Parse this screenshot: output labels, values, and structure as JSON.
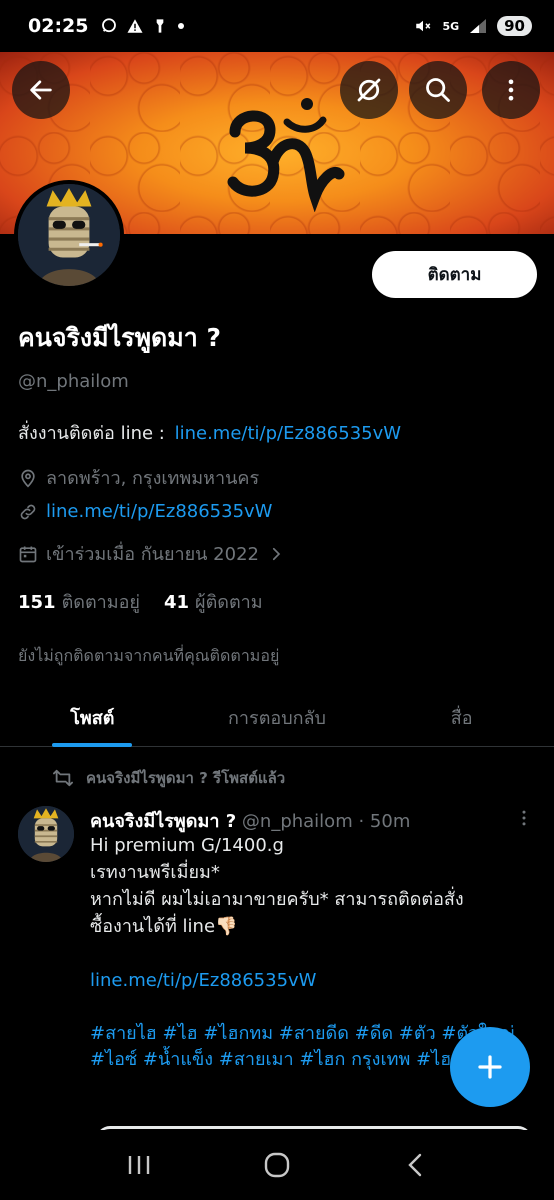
{
  "status_bar": {
    "time": "02:25",
    "network": "5G",
    "battery": "90"
  },
  "header": {
    "back_icon": "arrow-left-icon",
    "hide_icon": "eye-off-icon",
    "search_icon": "search-icon",
    "more_icon": "more-vertical-icon"
  },
  "profile": {
    "display_name": "คนจริงมีไรพูดมา ?",
    "handle": "@n_phailom",
    "follow_label": "ติดตาม",
    "bio_text": "สั่งงานติดต่อ line  :",
    "bio_link": "line.me/ti/p/Ez886535vW",
    "location": "ลาดพร้าว, กรุงเทพมหานคร",
    "website": "line.me/ti/p/Ez886535vW",
    "joined": "เข้าร่วมเมื่อ กันยายน 2022",
    "following_count": "151",
    "following_label": "ติดตามอยู่",
    "followers_count": "41",
    "followers_label": "ผู้ติดตาม",
    "not_followed_note": "ยังไม่ถูกติดตามจากคนที่คุณติดตามอยู่"
  },
  "tabs": [
    {
      "label": "โพสต์",
      "active": true
    },
    {
      "label": "การตอบกลับ",
      "active": false
    },
    {
      "label": "สื่อ",
      "active": false
    }
  ],
  "post": {
    "repost_text": "คนจริงมีไรพูดมา ? รีโพสต์แล้ว",
    "author_name": "คนจริงมีไรพูดมา ?",
    "author_handle": "@n_phailom",
    "time": "· 50m",
    "line1": "Hi premium G/1400.g",
    "line2": "เรทงานพรีเมี่ยม*",
    "line3": "หากไม่ดี ผมไม่เอามาขายครับ* สามารถติดต่อสั่ง",
    "line4": "ซื้องานได้ที่ line👎🏻",
    "link": "line.me/ti/p/Ez886535vW",
    "hashtags": "#สายไฮ #ไฮ #ไฮกทม #สายดีด #ดีด #ตัว #ตัวใหญ่ #ไอซ์ #น้ำแข็ง #สายเมา #ไฮก กรุงเทพ #ไฮกทม"
  },
  "fab": {
    "icon": "plus-icon"
  },
  "nav": {
    "recent": "recent-apps-icon",
    "home": "home-icon",
    "back": "back-icon"
  },
  "colors": {
    "accent": "#1d9bf0",
    "background": "#000000",
    "muted": "#71767b"
  }
}
